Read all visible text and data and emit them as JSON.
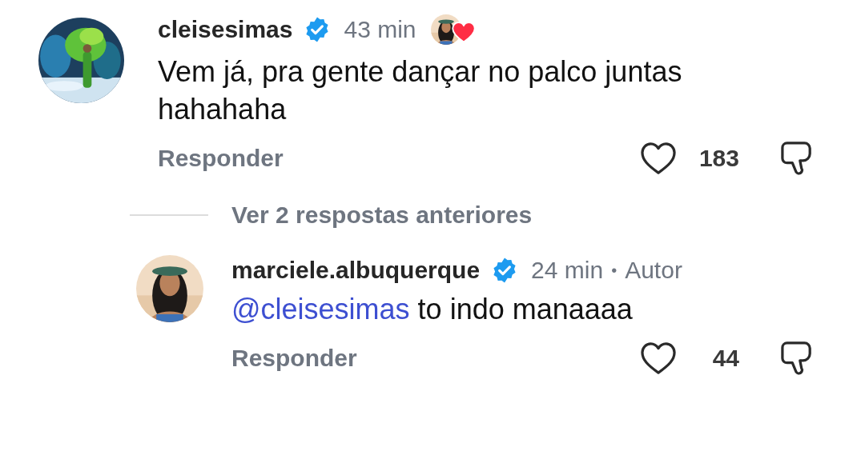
{
  "comment": {
    "username": "cleisesimas",
    "verified": true,
    "time": "43 min",
    "author_liked": true,
    "body": "Vem já, pra gente dançar no palco juntas hahahaha",
    "reply_label": "Responder",
    "likes": "183"
  },
  "replies_toggle": "Ver 2 respostas anteriores",
  "reply": {
    "username": "marciele.albuquerque",
    "verified": true,
    "time": "24 min",
    "separator": "•",
    "badge": "Autor",
    "mention": "@cleisesimas",
    "body": "to indo manaaaa",
    "reply_label": "Responder",
    "likes": "44"
  }
}
